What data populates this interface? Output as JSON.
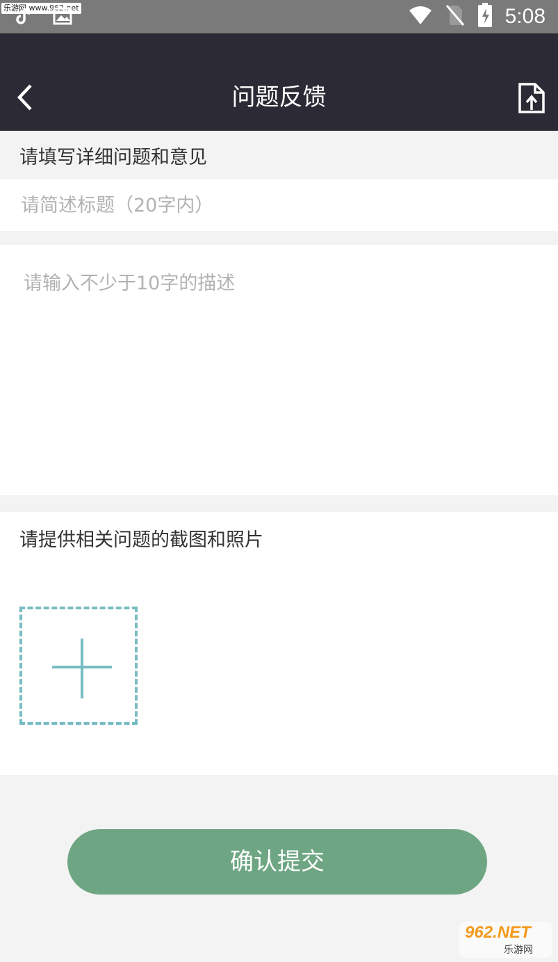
{
  "status_bar": {
    "watermark": "乐游网 www.962.net",
    "time": "5:08",
    "icons": [
      "tiktok-icon",
      "image-icon",
      "wifi-icon",
      "no-sim-icon",
      "battery-charging-icon"
    ]
  },
  "app_bar": {
    "title": "问题反馈",
    "back_icon": "chevron-left-icon",
    "share_icon": "file-upload-icon"
  },
  "form": {
    "details_label": "请填写详细问题和意见",
    "title_placeholder": "请简述标题（20字内）",
    "description_placeholder": "请输入不少于10字的描述",
    "photos_label": "请提供相关问题的截图和照片",
    "add_photo_icon": "plus-icon"
  },
  "submit_label": "确认提交",
  "watermark_badge": {
    "logo": "962.NET",
    "sub": "乐游网"
  },
  "colors": {
    "app_bar": "#2c2b35",
    "accent": "#6ea683",
    "dashed_border": "#76bcc2",
    "placeholder": "#b2b2b2"
  }
}
